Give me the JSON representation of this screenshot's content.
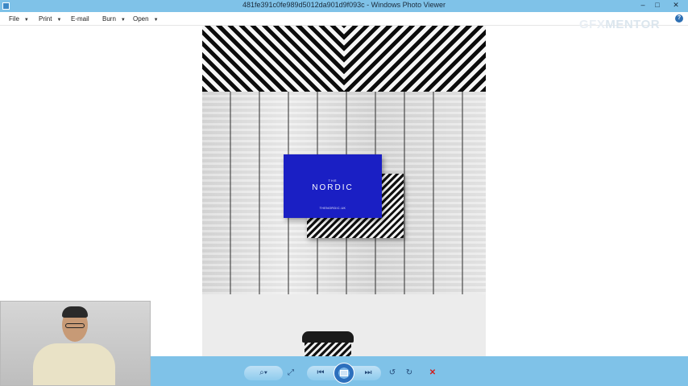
{
  "window": {
    "title": "481fe391c0fe989d5012da901d9f093c - Windows Photo Viewer",
    "minimize": "–",
    "maximize": "□",
    "close": "✕"
  },
  "menu": {
    "items": [
      {
        "label": "File",
        "caret": "▼"
      },
      {
        "label": "Print",
        "caret": "▼"
      },
      {
        "label": "E-mail",
        "caret": ""
      },
      {
        "label": "Burn",
        "caret": "▼"
      },
      {
        "label": "Open",
        "caret": "▼"
      }
    ],
    "help": "?"
  },
  "watermark": {
    "part1": "GFX",
    "part2": "MENTOR"
  },
  "photo": {
    "card_small_text": "THE",
    "card_title": "NORDIC",
    "card_website": "THENORDIC.UK",
    "colors": {
      "card_blue": "#1a1fc4"
    }
  },
  "toolbar": {
    "zoom": "⌕▾",
    "actual_size": "⤢",
    "previous": "⏮",
    "slideshow": "slideshow-icon",
    "next": "⏭",
    "rotate_ccw": "↺",
    "rotate_cw": "↻",
    "delete": "✕"
  },
  "colors": {
    "chrome": "#7fc2e8",
    "accent": "#2c6fbd",
    "delete": "#d21c1c"
  }
}
